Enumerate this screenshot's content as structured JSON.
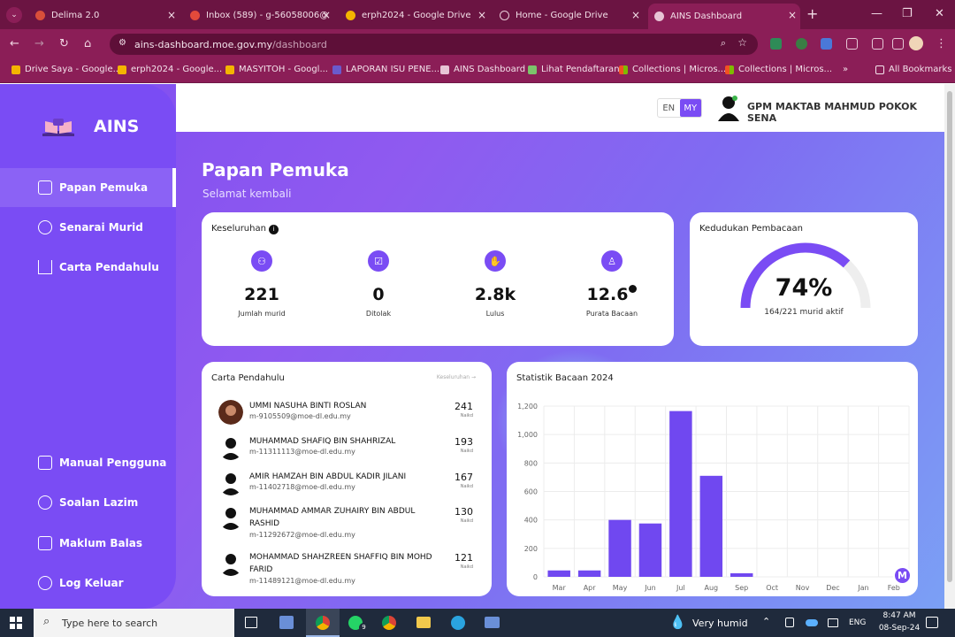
{
  "browser": {
    "tabs": [
      {
        "title": "Delima 2.0",
        "color": "#d94f3a"
      },
      {
        "title": "Inbox (589) - g-56058006@",
        "color": "#e24a3b"
      },
      {
        "title": "erph2024 - Google Drive",
        "color": "#f4b400"
      },
      {
        "title": "Home - Google Drive",
        "color": "#d6d6d6"
      },
      {
        "title": "AINS Dashboard",
        "color": "#c9376e"
      }
    ],
    "url_host": "ains-dashboard.moe.gov.my",
    "url_path": "/dashboard",
    "bookmarks": [
      "Drive Saya - Google...",
      "erph2024 - Google...",
      "MASYITOH - Googl...",
      "LAPORAN ISU PENE...",
      "AINS Dashboard",
      "Lihat Pendaftaran",
      "Collections | Micros...",
      "Collections | Micros...",
      "All Bookmarks"
    ]
  },
  "sidebar": {
    "brand": "AINS",
    "items": [
      {
        "label": "Papan Pemuka",
        "active": true,
        "icon": "grid-icon"
      },
      {
        "label": "Senarai Murid",
        "active": false,
        "icon": "users-icon"
      },
      {
        "label": "Carta Pendahulu",
        "active": false,
        "icon": "podium-icon"
      }
    ],
    "bottom_items": [
      {
        "label": "Manual Pengguna",
        "icon": "book-icon"
      },
      {
        "label": "Soalan Lazim",
        "icon": "question-icon"
      },
      {
        "label": "Maklum Balas",
        "icon": "feedback-icon"
      },
      {
        "label": "Log Keluar",
        "icon": "logout-icon"
      }
    ]
  },
  "header": {
    "lang_en": "EN",
    "lang_my": "MY",
    "school": "GPM MAKTAB MAHMUD POKOK SENA"
  },
  "page": {
    "title": "Papan Pemuka",
    "subtitle": "Selamat kembali"
  },
  "overview": {
    "title": "Keseluruhan",
    "stats": [
      {
        "value": "221",
        "label": "Jumlah murid"
      },
      {
        "value": "0",
        "label": "Ditolak"
      },
      {
        "value": "2.8k",
        "label": "Lulus"
      },
      {
        "value": "12.6",
        "label": "Purata Bacaan"
      }
    ]
  },
  "reading_rank": {
    "title": "Kedudukan Pembacaan",
    "percent": "74%",
    "detail": "164/221 murid aktif",
    "fraction": 0.74
  },
  "leaderboard": {
    "title": "Carta Pendahulu",
    "link": "Keseluruhan →",
    "rows": [
      {
        "name": "UMMI NASUHA BINTI ROSLAN",
        "email": "m-9105509@moe-dl.edu.my",
        "score": "241",
        "rank_label": "Naikd"
      },
      {
        "name": "MUHAMMAD SHAFIQ BIN SHAHRIZAL",
        "email": "m-11311113@moe-dl.edu.my",
        "score": "193",
        "rank_label": "Naikd"
      },
      {
        "name": "AMIR HAMZAH BIN ABDUL KADIR JILANI",
        "email": "m-11402718@moe-dl.edu.my",
        "score": "167",
        "rank_label": "Naikd"
      },
      {
        "name": "MUHAMMAD AMMAR ZUHAIRY BIN ABDUL RASHID",
        "email": "m-11292672@moe-dl.edu.my",
        "score": "130",
        "rank_label": "Naikd"
      },
      {
        "name": "MOHAMMAD SHAHZREEN SHAFFIQ BIN MOHD FARID",
        "email": "m-11489121@moe-dl.edu.my",
        "score": "121",
        "rank_label": "Naikd"
      }
    ]
  },
  "chart_data": {
    "type": "bar",
    "title": "Statistik Bacaan 2024",
    "categories": [
      "Mar",
      "Apr",
      "May",
      "Jun",
      "Jul",
      "Aug",
      "Sep",
      "Oct",
      "Nov",
      "Dec",
      "Jan",
      "Feb"
    ],
    "values": [
      45,
      45,
      400,
      375,
      1165,
      710,
      25,
      0,
      0,
      0,
      0,
      0
    ],
    "ylim": [
      0,
      1200
    ],
    "yticks": [
      "0",
      "200",
      "400",
      "600",
      "800",
      "1,000",
      "1,200"
    ],
    "grid": true,
    "color": "#7048f0"
  },
  "taskbar": {
    "search": "Type here to search",
    "weather": "Very humid",
    "lang": "ENG",
    "time": "8:47 AM",
    "date": "08-Sep-24",
    "badge": "9"
  }
}
